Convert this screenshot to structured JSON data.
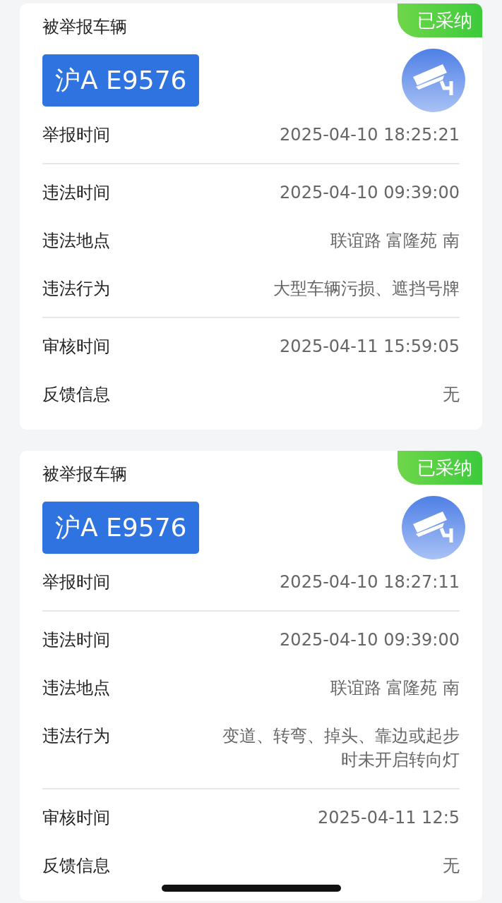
{
  "records": [
    {
      "vehicle_label": "被举报车辆",
      "status": "已采纳",
      "plate": "沪A E9576",
      "sections": [
        [
          {
            "label": "举报时间",
            "value": "2025-04-10 18:25:21"
          }
        ],
        [
          {
            "label": "违法时间",
            "value": "2025-04-10 09:39:00"
          },
          {
            "label": "违法地点",
            "value": "联谊路 富隆苑 南"
          },
          {
            "label": "违法行为",
            "value": "大型车辆污损、遮挡号牌"
          }
        ],
        [
          {
            "label": "审核时间",
            "value": "2025-04-11 15:59:05"
          },
          {
            "label": "反馈信息",
            "value": "无"
          }
        ]
      ]
    },
    {
      "vehicle_label": "被举报车辆",
      "status": "已采纳",
      "plate": "沪A E9576",
      "sections": [
        [
          {
            "label": "举报时间",
            "value": "2025-04-10 18:27:11"
          }
        ],
        [
          {
            "label": "违法时间",
            "value": "2025-04-10 09:39:00"
          },
          {
            "label": "违法地点",
            "value": "联谊路 富隆苑 南"
          },
          {
            "label": "违法行为",
            "value": "变道、转弯、掉头、靠边或起步时未开启转向灯"
          }
        ],
        [
          {
            "label": "审核时间",
            "value": "2025-04-11 12:5"
          },
          {
            "label": "反馈信息",
            "value": "无"
          }
        ]
      ]
    }
  ]
}
